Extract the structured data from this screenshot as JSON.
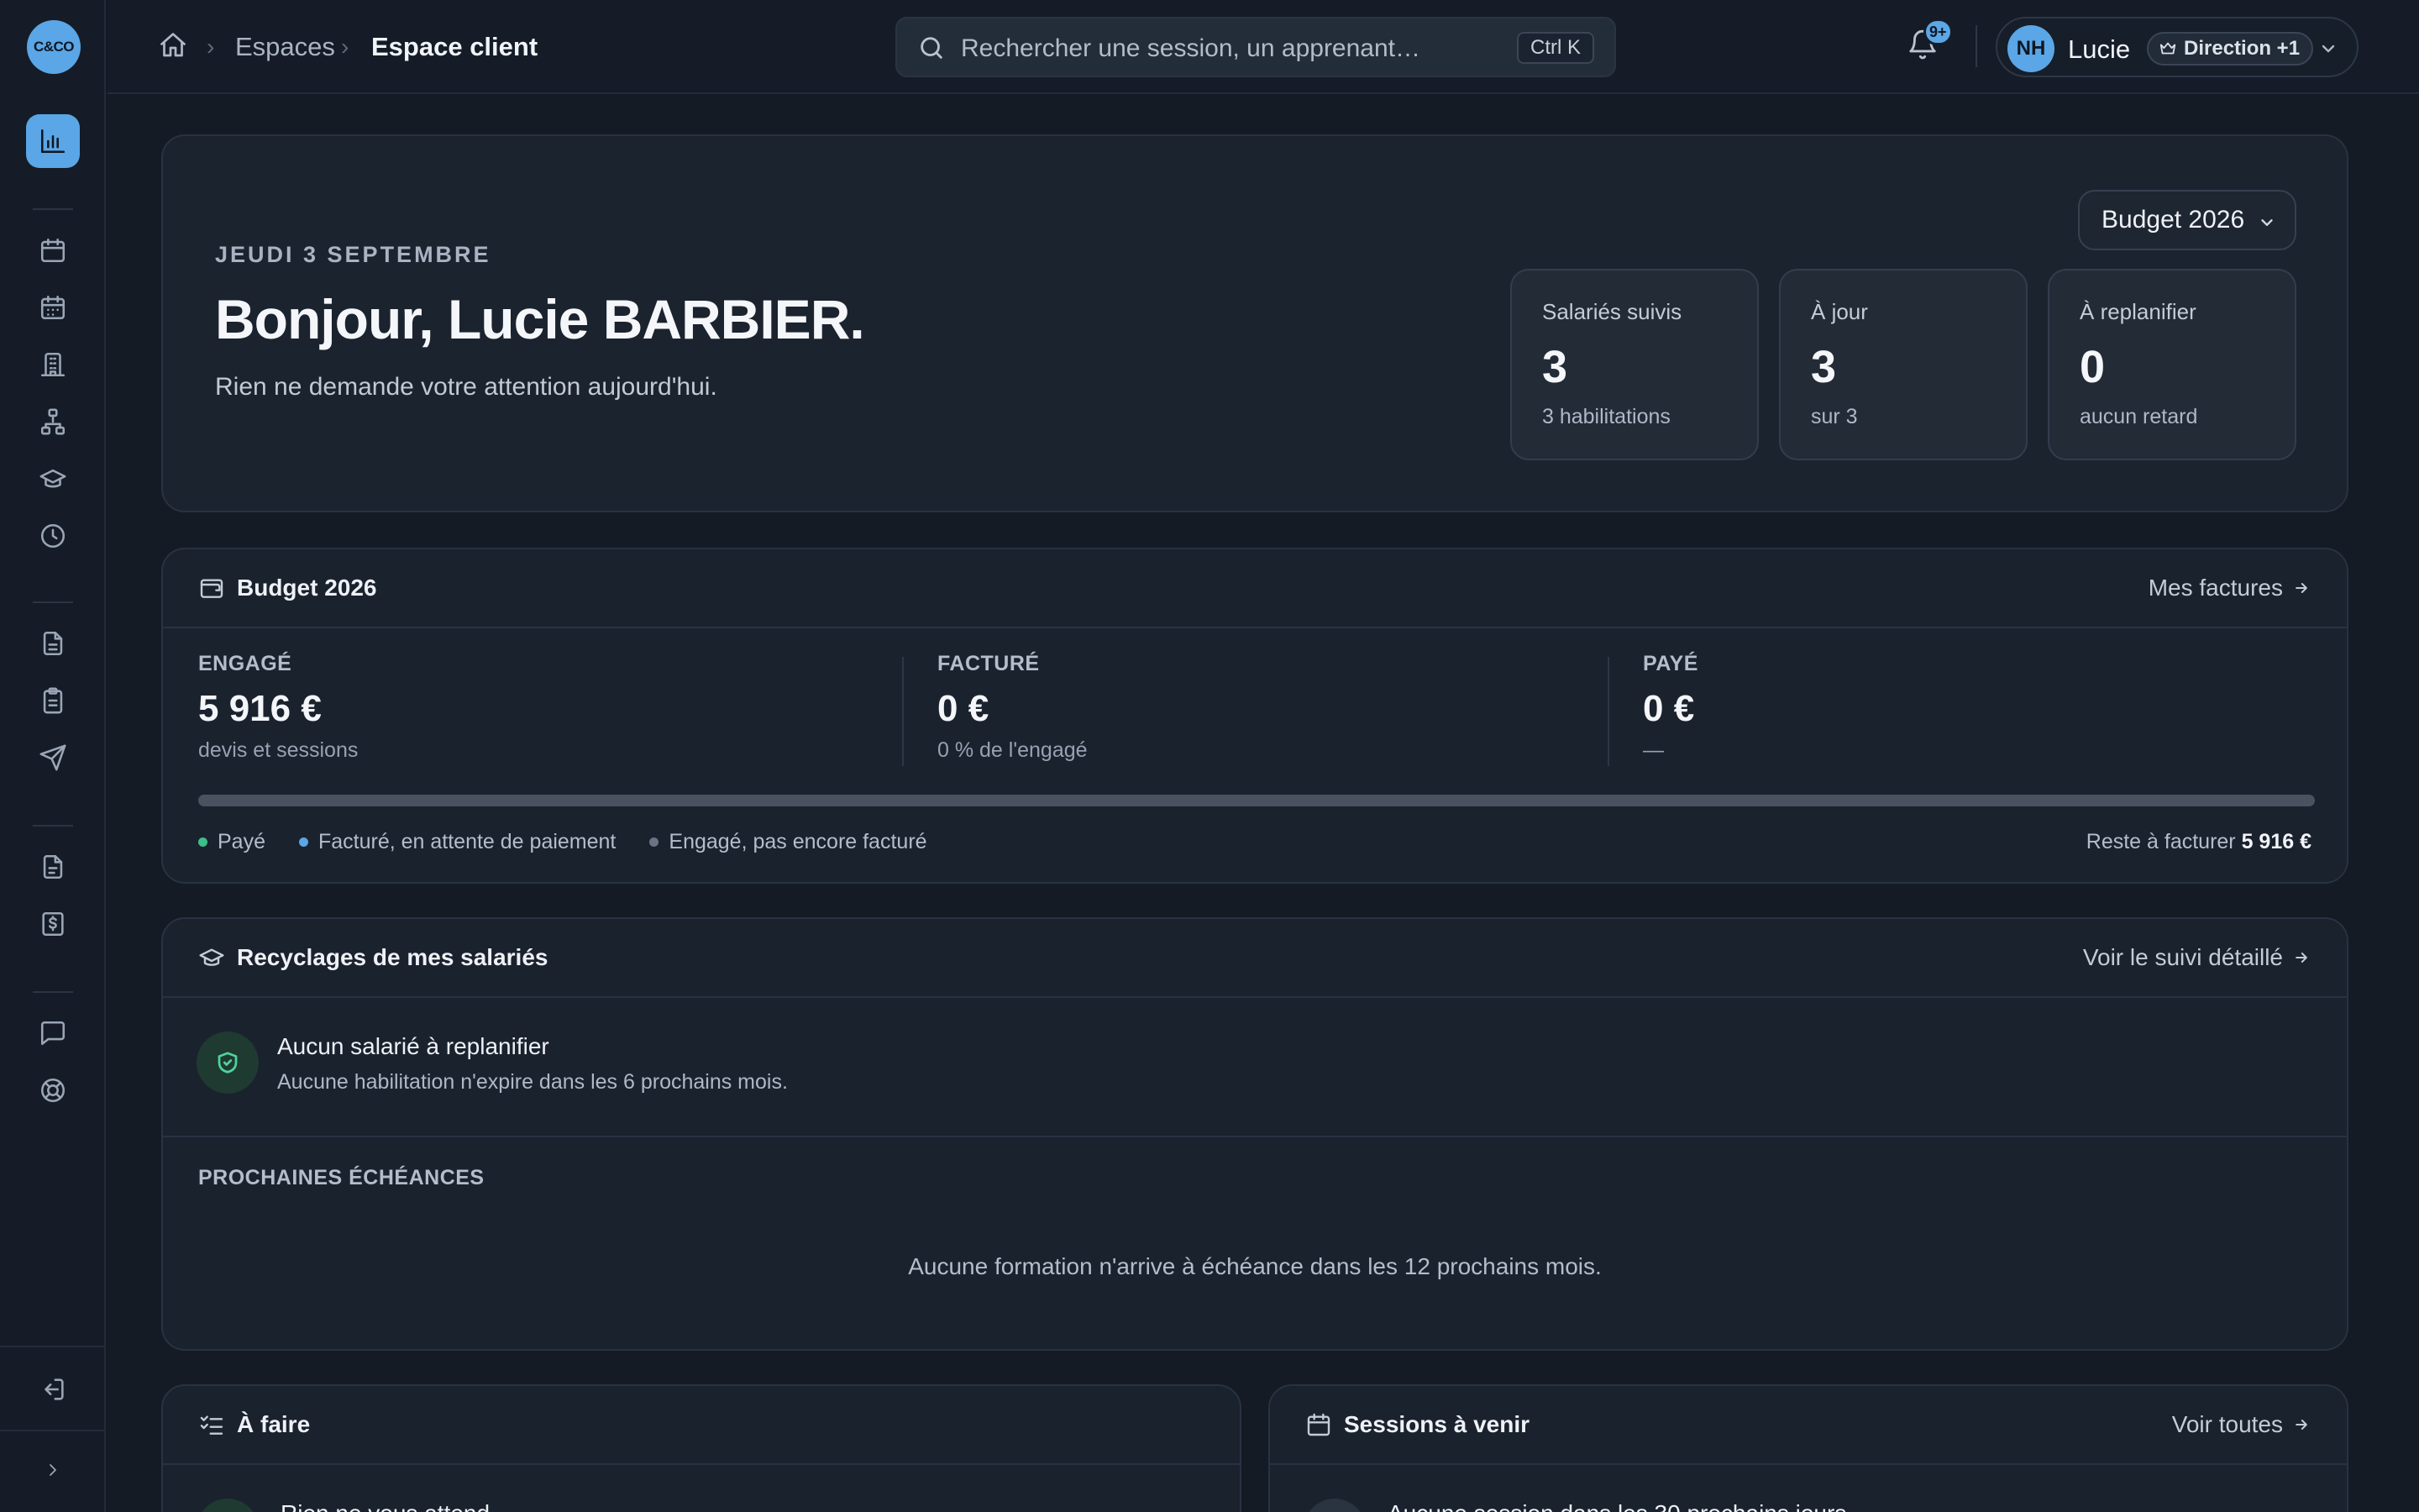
{
  "app": {
    "logo": "C&CO"
  },
  "breadcrumb": {
    "parent": "Espaces",
    "current": "Espace client"
  },
  "search": {
    "placeholder": "Rechercher une session, un apprenant…",
    "shortcut": "Ctrl K"
  },
  "notifications": {
    "badge": "9+"
  },
  "user": {
    "initials": "NH",
    "name": "Lucie",
    "role": "Direction +1"
  },
  "hero": {
    "date": "JEUDI 3 SEPTEMBRE",
    "greeting": "Bonjour, Lucie BARBIER.",
    "subtitle": "Rien ne demande votre attention aujourd'hui.",
    "budget_select": "Budget 2026",
    "stats": [
      {
        "label": "Salariés suivis",
        "value": "3",
        "sub": "3 habilitations"
      },
      {
        "label": "À jour",
        "value": "3",
        "sub": "sur 3"
      },
      {
        "label": "À replanifier",
        "value": "0",
        "sub": "aucun retard"
      }
    ]
  },
  "budget": {
    "title": "Budget 2026",
    "link": "Mes factures",
    "kpis": [
      {
        "label": "ENGAGÉ",
        "value": "5 916 €",
        "sub": "devis et sessions"
      },
      {
        "label": "FACTURÉ",
        "value": "0 €",
        "sub": "0 % de l'engagé"
      },
      {
        "label": "PAYÉ",
        "value": "0 €",
        "sub": "—"
      }
    ],
    "paid_fraction": 0,
    "legend": [
      {
        "label": "Payé",
        "color": "#3cbf8a"
      },
      {
        "label": "Facturé, en attente de paiement",
        "color": "#5aa6e6"
      },
      {
        "label": "Engagé, pas encore facturé",
        "color": "#6b7483"
      }
    ],
    "remaining_label": "Reste à facturer",
    "remaining_value": "5 916 €"
  },
  "recyclages": {
    "title": "Recyclages de mes salariés",
    "link": "Voir le suivi détaillé",
    "ok_title": "Aucun salarié à replanifier",
    "ok_sub": "Aucune habilitation n'expire dans les 6 prochains mois.",
    "next_label": "PROCHAINES ÉCHÉANCES",
    "next_empty": "Aucune formation n'arrive à échéance dans les 12 prochains mois."
  },
  "todo": {
    "title": "À faire",
    "first_item": "Rien ne vous attend"
  },
  "sessions": {
    "title": "Sessions à venir",
    "link": "Voir toutes",
    "first_item": "Aucune session dans les 30 prochains jours"
  }
}
